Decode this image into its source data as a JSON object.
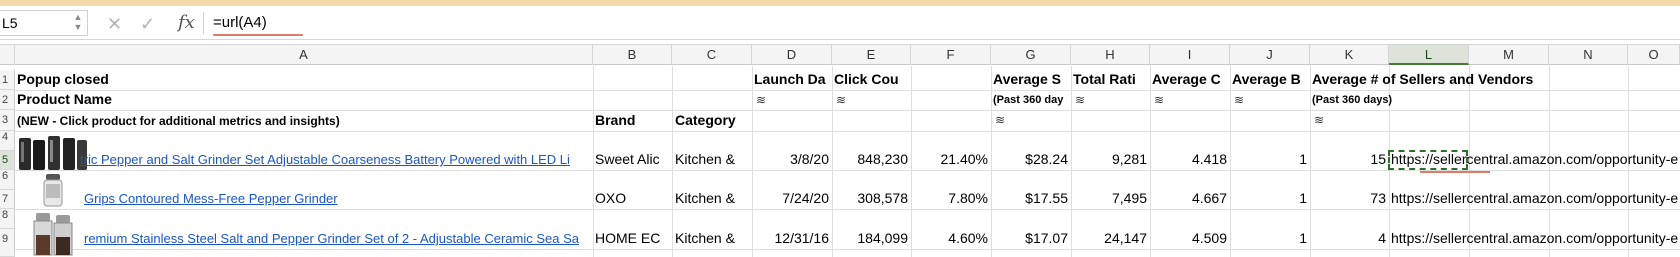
{
  "formula_bar": {
    "cell_ref": "L5",
    "formula": "=url(A4)",
    "fx_label": "fx"
  },
  "columns": [
    "A",
    "B",
    "C",
    "D",
    "E",
    "F",
    "G",
    "H",
    "I",
    "J",
    "K",
    "L",
    "M",
    "N",
    "O"
  ],
  "rows": [
    "1",
    "2",
    "3",
    "4",
    "5",
    "6",
    "7",
    "8",
    "9"
  ],
  "header": {
    "a1": "Popup closed",
    "a2": "Product Name",
    "a3": "(NEW - Click product for additional metrics and insights)",
    "b3": "Brand",
    "c3": "Category",
    "d1": "Launch Da",
    "e1": "Click Cou",
    "g1": "Average S",
    "g2": "(Past 360 day",
    "h1": "Total Rati",
    "i1": "Average C",
    "j1": "Average B",
    "k1": "Average # of Sellers and Vendors",
    "k2": "(Past 360 days)",
    "wave_symbol": "≋"
  },
  "products": [
    {
      "name": "tric Pepper and Salt Grinder Set Adjustable Coarseness Battery Powered with LED Li",
      "brand": "Sweet Alic",
      "category": "Kitchen &",
      "launch": "3/8/20",
      "clicks": "848,230",
      "pct": "21.40%",
      "price": "$28.24",
      "ratings": "9,281",
      "avg_rating": "4.418",
      "avg_b": "1",
      "sellers": "15",
      "url": "https://sellercentral.amazon.com/opportunity-e"
    },
    {
      "name": "Grips Contoured Mess-Free Pepper Grinder",
      "brand": "OXO",
      "category": "Kitchen &",
      "launch": "7/24/20",
      "clicks": "308,578",
      "pct": "7.80%",
      "price": "$17.55",
      "ratings": "7,495",
      "avg_rating": "4.667",
      "avg_b": "1",
      "sellers": "73",
      "url": "https://sellercentral.amazon.com/opportunity-e"
    },
    {
      "name": "remium Stainless Steel Salt and Pepper Grinder Set of 2 - Adjustable Ceramic Sea Sa",
      "brand": "HOME EC",
      "category": "Kitchen &",
      "launch": "12/31/16",
      "clicks": "184,099",
      "pct": "4.60%",
      "price": "$17.07",
      "ratings": "24,147",
      "avg_rating": "4.509",
      "avg_b": "1",
      "sellers": "4",
      "url": "https://sellercentral.amazon.com/opportunity-e"
    }
  ]
}
